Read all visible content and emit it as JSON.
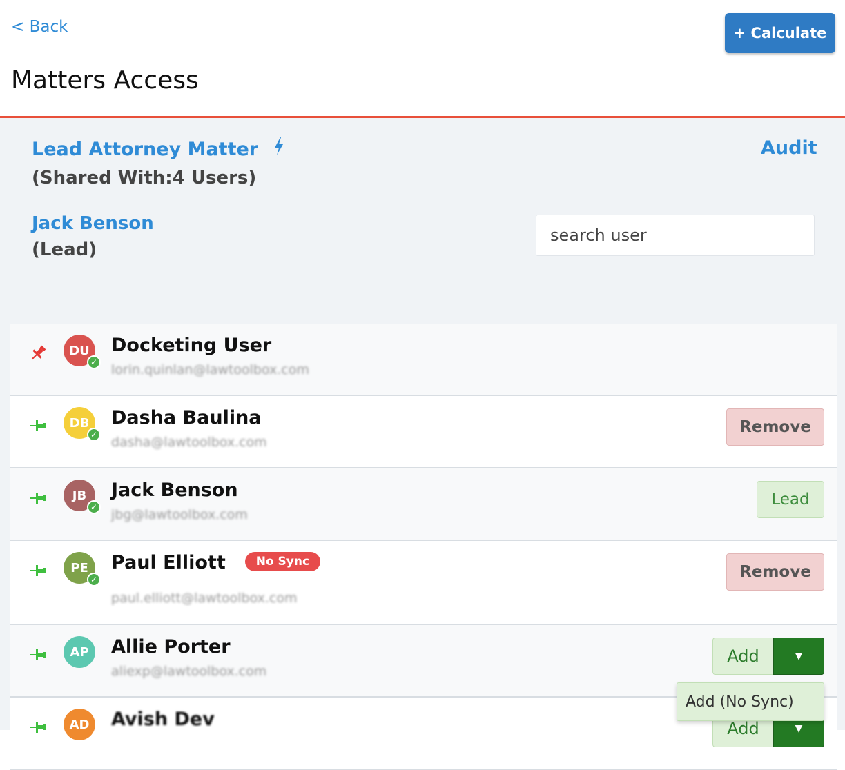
{
  "header": {
    "back_label": "< Back",
    "calculate_label": "+ Calculate",
    "title": "Matters Access"
  },
  "matter": {
    "title": "Lead Attorney Matter",
    "shared_text": "(Shared With:4 Users)",
    "audit_label": "Audit",
    "lead_name": "Jack Benson",
    "lead_role": "(Lead)",
    "search_placeholder": "search user"
  },
  "colors": {
    "accent": "#2f8bd6",
    "divider": "#e8503a",
    "pin_red": "#e53935",
    "pin_green": "#3fbf3f"
  },
  "users": [
    {
      "initials": "DU",
      "name": "Docketing User",
      "email": "lorin.quinlan@lawtoolbox.com",
      "avatar_color": "#d9534f",
      "pin": "red",
      "verified": true,
      "action": ""
    },
    {
      "initials": "DB",
      "name": "Dasha Baulina",
      "email": "dasha@lawtoolbox.com",
      "avatar_color": "#f5cf3a",
      "pin": "green",
      "verified": true,
      "action": "Remove"
    },
    {
      "initials": "JB",
      "name": "Jack Benson",
      "email": "jbg@lawtoolbox.com",
      "avatar_color": "#a86363",
      "pin": "green",
      "verified": true,
      "action": "Lead"
    },
    {
      "initials": "PE",
      "name": "Paul Elliott",
      "badge": "No Sync",
      "email": "paul.elliott@lawtoolbox.com",
      "avatar_color": "#7fa24a",
      "pin": "green",
      "verified": true,
      "action": "Remove"
    },
    {
      "initials": "AP",
      "name": "Allie Porter",
      "email": "aliexp@lawtoolbox.com",
      "avatar_color": "#5cc8b0",
      "pin": "green",
      "verified": false,
      "action": "Add"
    },
    {
      "initials": "AD",
      "name": "Avish Dev",
      "email": "",
      "avatar_color": "#ef8a2f",
      "pin": "green",
      "verified": false,
      "action": "Add"
    }
  ],
  "dropdown": {
    "option": "Add (No Sync)"
  }
}
